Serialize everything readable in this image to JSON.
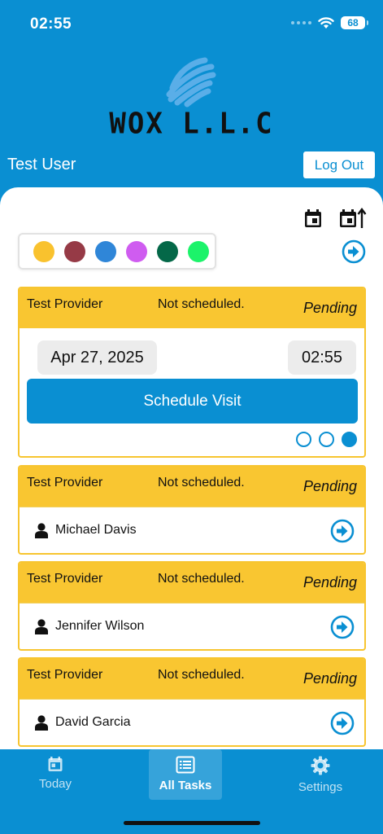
{
  "status_bar": {
    "time": "02:55",
    "battery": "68"
  },
  "logo": {
    "text": "WOX L.L.C",
    "accent_color": "#5aaee8"
  },
  "header": {
    "user_name": "Test User",
    "logout_label": "Log Out"
  },
  "filter": {
    "colors": [
      "#f9c22e",
      "#963a46",
      "#2f86d8",
      "#cf5cf0",
      "#046848",
      "#1cf36a"
    ]
  },
  "tasks": [
    {
      "provider": "Test Provider",
      "schedule": "Not scheduled.",
      "status": "Pending",
      "expanded": true,
      "date": "Apr 27, 2025",
      "time": "02:55",
      "action_label": "Schedule Visit",
      "pager_count": 3,
      "pager_active": 2
    },
    {
      "provider": "Test Provider",
      "schedule": "Not scheduled.",
      "status": "Pending",
      "person": "Michael Davis"
    },
    {
      "provider": "Test Provider",
      "schedule": "Not scheduled.",
      "status": "Pending",
      "person": "Jennifer Wilson"
    },
    {
      "provider": "Test Provider",
      "schedule": "Not scheduled.",
      "status": "Pending",
      "person": "David Garcia"
    }
  ],
  "tabs": [
    {
      "label": "Today",
      "icon": "calendar-icon",
      "active": false
    },
    {
      "label": "All Tasks",
      "icon": "list-icon",
      "active": true
    },
    {
      "label": "Settings",
      "icon": "gear-icon",
      "active": false
    }
  ],
  "theme": {
    "primary": "#0a8fd2",
    "card_header": "#f9c631"
  }
}
